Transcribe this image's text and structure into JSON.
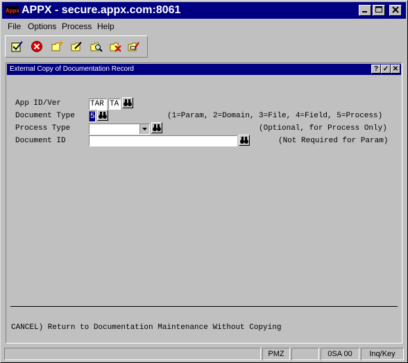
{
  "window": {
    "title": "APPX - secure.appx.com:8061"
  },
  "menu": [
    "File",
    "Options",
    "Process",
    "Help"
  ],
  "toolbar": {
    "tools": [
      "checkmark-icon",
      "cancel-icon",
      "new-record-icon",
      "edit-record-icon",
      "inquire-record-icon",
      "delete-record-icon",
      "print-record-icon"
    ]
  },
  "form": {
    "title": "External Copy of Documentation Record",
    "title_buttons": [
      "?",
      "✓",
      "✕"
    ],
    "fields": {
      "app_id": {
        "label": "App ID/Ver",
        "value1": "TAR",
        "value2": "TA"
      },
      "doc_type": {
        "label": "Document Type",
        "value": "5",
        "hint": "(1=Param, 2=Domain, 3=File, 4=Field, 5=Process)"
      },
      "process_type": {
        "label": "Process Type",
        "value": "",
        "hint": "(Optional, for Process Only)"
      },
      "doc_id": {
        "label": "Document ID",
        "value": "",
        "hint": "(Not Required for Param)"
      }
    },
    "cancel_text": "CANCEL) Return to Documentation Maintenance Without Copying"
  },
  "status": {
    "cells": [
      "",
      "PMZ",
      "",
      "0SA 00",
      "Inq/Key"
    ]
  },
  "colors": {
    "titlebar": "#000080",
    "face": "#c0c0c0"
  }
}
